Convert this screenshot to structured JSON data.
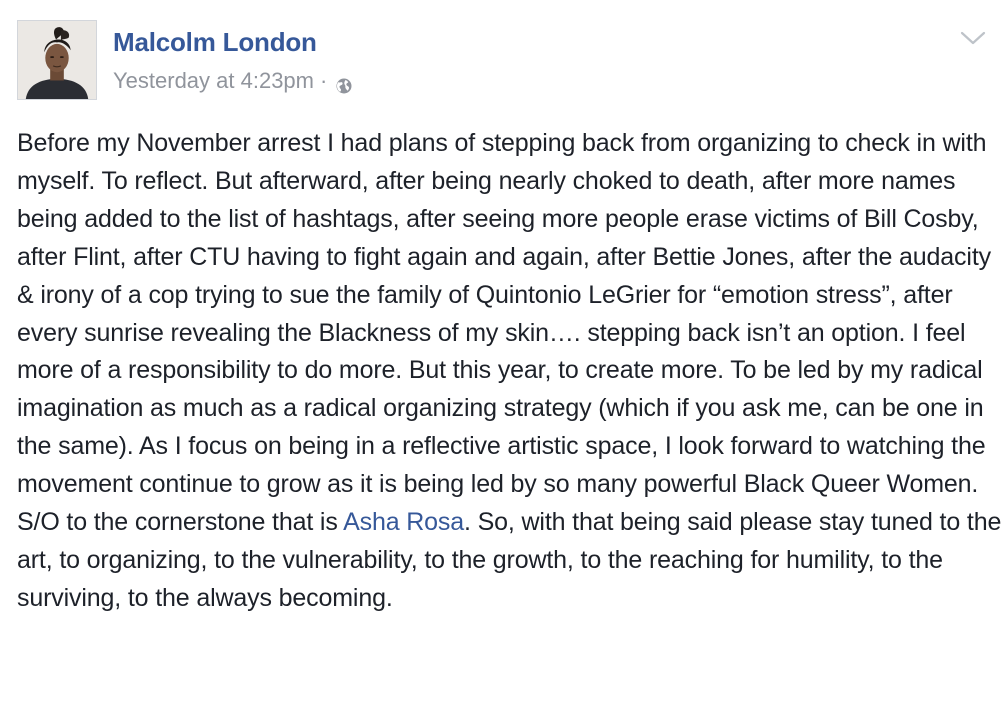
{
  "post": {
    "author": "Malcolm London",
    "timestamp": "Yesterday at 4:23pm",
    "separator": "·",
    "privacy_icon": "globe-icon",
    "menu_icon": "chevron-down-icon",
    "text_before_mention": "Before my November arrest I had plans of stepping back from organizing to check in with myself. To reflect. But afterward, after being nearly choked to death, after more names being added to the list of hashtags, after seeing more people erase victims of Bill Cosby, after Flint, after CTU having to fight again and again, after Bettie Jones, after the audacity & irony of a cop trying to sue the family of Quintonio LeGrier for “emotion stress”, after every sunrise revealing the Blackness of my skin…. stepping back isn’t an option. I feel more of a responsibility to do more. But this year, to create more. To be led by my radical imagination as much as a radical organizing strategy (which if you ask me, can be one in the same). As I focus on being in a reflective artistic space, I look forward to watching the movement continue to grow as it is being led by so many powerful Black Queer Women. S/O to the cornerstone that is ",
    "mention": "Asha Rosa",
    "text_after_mention": ". So, with that being said please stay tuned to the art, to organizing, to the vulnerability, to the growth, to the reaching for humility, to the surviving, to the always becoming."
  },
  "colors": {
    "author_link": "#365899",
    "meta_gray": "#90949c",
    "body_text": "#1d2129"
  }
}
